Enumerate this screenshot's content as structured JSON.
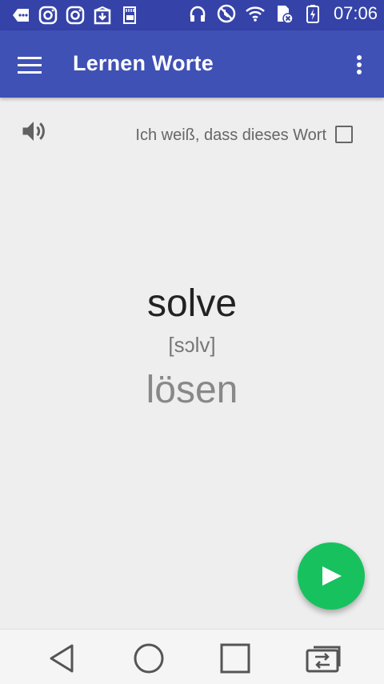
{
  "status_bar": {
    "time": "07:06",
    "left_icons": [
      "message-icon",
      "instagram-icon",
      "instagram-icon",
      "download-box-icon",
      "sd-card-icon"
    ],
    "right_icons": [
      "headphones-icon",
      "do-not-disturb-icon",
      "wifi-icon",
      "sim-x-icon",
      "battery-charging-icon"
    ]
  },
  "app_bar": {
    "title": "Lernen Worte",
    "menu_icon": "hamburger-icon",
    "more_icon": "more-vert-icon"
  },
  "card": {
    "speaker_icon": "volume-icon",
    "known_label": "Ich weiß, dass dieses Wort",
    "known_checked": false,
    "word": "solve",
    "transcription": "[sɔlv]",
    "translation": "lösen"
  },
  "fab": {
    "icon": "play-icon",
    "color": "#17c25e"
  },
  "nav_bar": {
    "buttons": [
      "back-icon",
      "home-icon",
      "recents-icon",
      "switch-icon"
    ]
  },
  "colors": {
    "primary": "#3f51b5",
    "primary_dark": "#3543a8",
    "background": "#eeeeee"
  }
}
